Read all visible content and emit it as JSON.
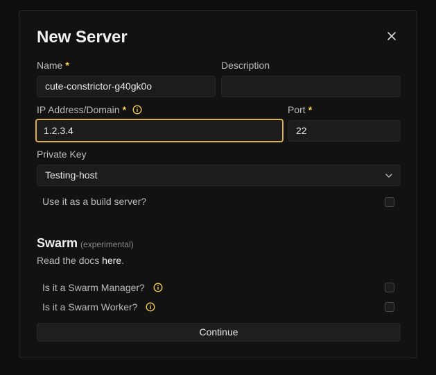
{
  "modal": {
    "title": "New Server"
  },
  "form": {
    "name": {
      "label": "Name",
      "required_mark": "*",
      "value": "cute-constrictor-g40gk0o"
    },
    "description": {
      "label": "Description",
      "value": ""
    },
    "ip": {
      "label": "IP Address/Domain",
      "required_mark": "*",
      "value": "1.2.3.4"
    },
    "port": {
      "label": "Port",
      "required_mark": "*",
      "value": "22"
    },
    "private_key": {
      "label": "Private Key",
      "selected": "Testing-host"
    },
    "build_server": {
      "label": "Use it as a build server?",
      "checked": false
    }
  },
  "swarm": {
    "title": "Swarm",
    "subtitle": "(experimental)",
    "docs_prefix": "Read the docs ",
    "docs_link": "here",
    "docs_suffix": ".",
    "manager": {
      "label": "Is it a Swarm Manager?",
      "checked": false
    },
    "worker": {
      "label": "Is it a Swarm Worker?",
      "checked": false
    }
  },
  "actions": {
    "continue_label": "Continue"
  },
  "colors": {
    "accent": "#fcd34d",
    "focus_border": "#d9b04a",
    "background": "#0e0e0e",
    "modal_bg": "#121212"
  },
  "icons": {
    "close": "close-icon",
    "info": "info-icon",
    "chevron": "chevron-down-icon"
  }
}
